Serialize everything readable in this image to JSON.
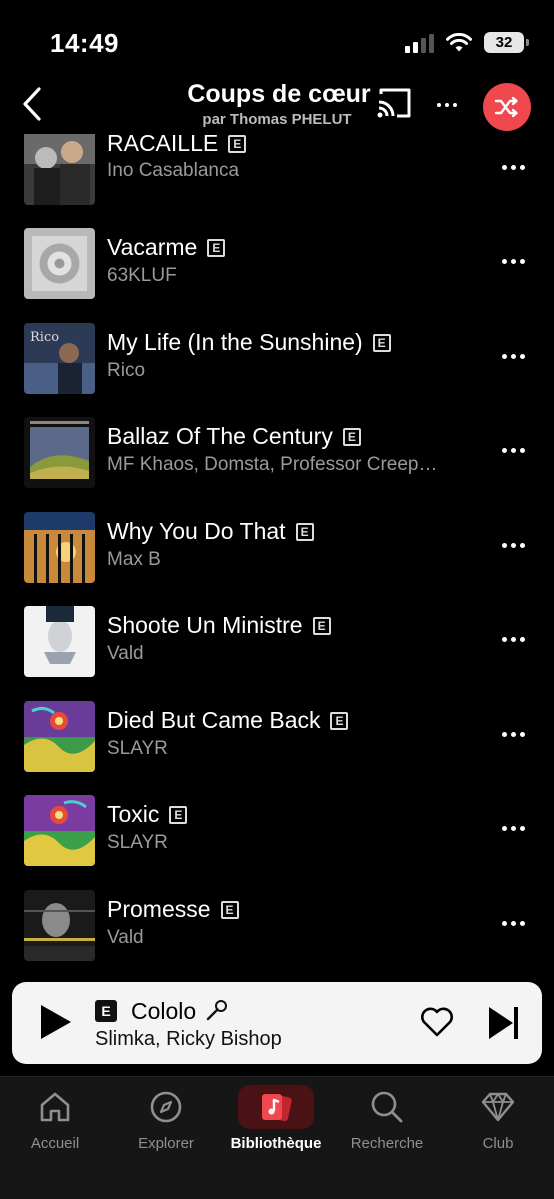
{
  "status_bar": {
    "time": "14:49",
    "battery": "32"
  },
  "header": {
    "title": "Coups de cœur",
    "subtitle": "par Thomas PHELUT"
  },
  "colors": {
    "accent": "#f0484f",
    "background": "#000000",
    "secondary_text": "#9a9a9a"
  },
  "tracks": [
    {
      "title": "RACAILLE",
      "artist": "Ino Casablanca",
      "explicit": "E"
    },
    {
      "title": "Vacarme",
      "artist": "63KLUF",
      "explicit": "E"
    },
    {
      "title": "My Life (In the Sunshine)",
      "artist": "Rico",
      "explicit": "E"
    },
    {
      "title": "Ballaz Of The Century",
      "artist": "MF Khaos, Domsta, Professor Creep…",
      "explicit": "E"
    },
    {
      "title": "Why You Do That",
      "artist": "Max B",
      "explicit": "E"
    },
    {
      "title": "Shoote Un Ministre",
      "artist": "Vald",
      "explicit": "E"
    },
    {
      "title": "Died But Came Back",
      "artist": "SLAYR",
      "explicit": "E"
    },
    {
      "title": "Toxic",
      "artist": "SLAYR",
      "explicit": "E"
    },
    {
      "title": "Promesse",
      "artist": "Vald",
      "explicit": "E"
    }
  ],
  "mini_player": {
    "explicit": "E",
    "title": "Cololo",
    "artist": "Slimka, Ricky Bishop"
  },
  "tabs": [
    {
      "label": "Accueil",
      "icon": "home-icon"
    },
    {
      "label": "Explorer",
      "icon": "compass-icon"
    },
    {
      "label": "Bibliothèque",
      "icon": "library-icon",
      "active": true
    },
    {
      "label": "Recherche",
      "icon": "search-icon"
    },
    {
      "label": "Club",
      "icon": "diamond-icon"
    }
  ]
}
